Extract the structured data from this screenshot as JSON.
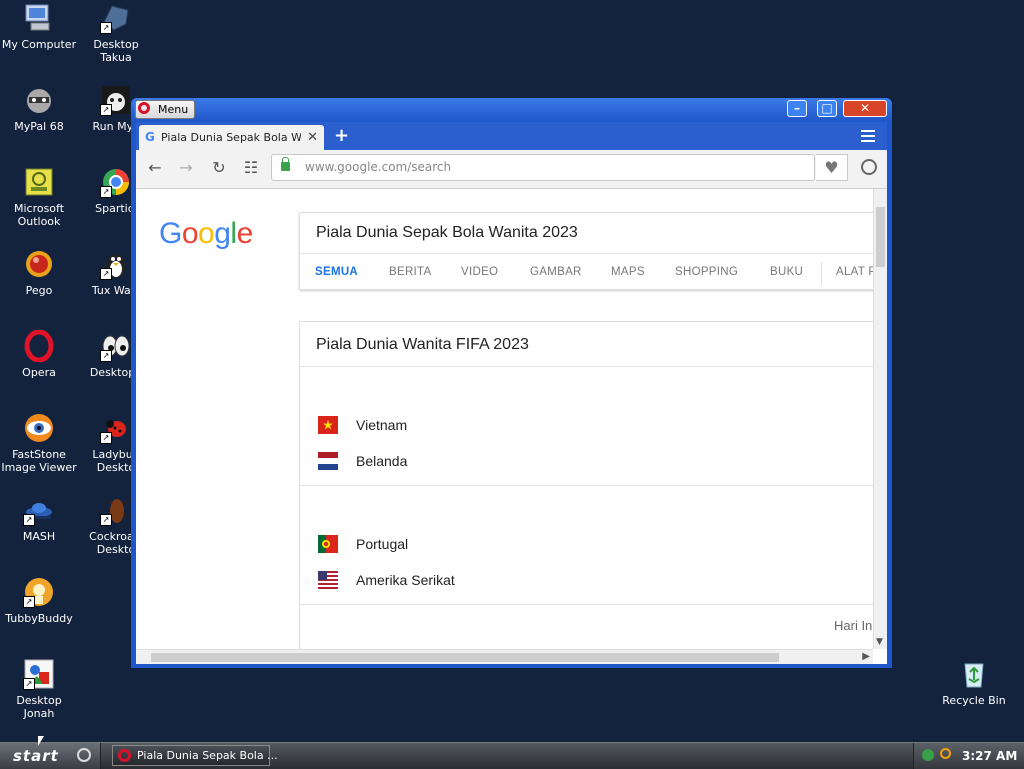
{
  "desktop": {
    "icons": [
      {
        "label": "My Computer"
      },
      {
        "label": "Desktop Takua"
      },
      {
        "label": "MyPal 68"
      },
      {
        "label": "Run MyF"
      },
      {
        "label": "Microsoft\nOutlook"
      },
      {
        "label": "Sparticl"
      },
      {
        "label": "Pego"
      },
      {
        "label": "Tux Walk"
      },
      {
        "label": "Opera"
      },
      {
        "label": "DesktopE"
      },
      {
        "label": "FastStone\nImage Viewer"
      },
      {
        "label": "Ladybug\nDeskto"
      },
      {
        "label": "MASH"
      },
      {
        "label": "Cockroacl\nDeskto"
      },
      {
        "label": "TubbyBuddy"
      },
      {
        "label": "Desktop Jonah"
      },
      {
        "label": "Recycle Bin"
      }
    ]
  },
  "window": {
    "menu_label": "Menu",
    "min": "–",
    "max": "□",
    "close": "✕"
  },
  "tab": {
    "title": "Piala Dunia Sepak Bola Wanita",
    "close": "✕",
    "favicon": "G",
    "new_tab": "+"
  },
  "nav": {
    "back": "←",
    "forward": "→",
    "reload": "↻",
    "speed_dial": "☷",
    "url_host": "www.google.com",
    "url_path": "/search",
    "heart": "♥"
  },
  "search": {
    "logo": [
      "G",
      "o",
      "o",
      "g",
      "l",
      "e"
    ],
    "logo_colors": [
      "#4285f4",
      "#ea4335",
      "#fbbc05",
      "#4285f4",
      "#34a853",
      "#ea4335"
    ],
    "query": "Piala Dunia Sepak Bola Wanita 2023",
    "tabs": [
      "SEMUA",
      "BERITA",
      "VIDEO",
      "GAMBAR",
      "MAPS",
      "SHOPPING",
      "BUKU",
      "ALAT P"
    ],
    "active_tab": "SEMUA"
  },
  "result": {
    "title": "Piala Dunia Wanita FIFA 2023",
    "matches": [
      {
        "team1": "Vietnam",
        "team2": "Belanda"
      },
      {
        "team1": "Portugal",
        "team2": "Amerika Serikat"
      }
    ],
    "footer": "Hari In"
  },
  "taskbar": {
    "start": "start",
    "task_title": "Piala Dunia Sepak Bola ...",
    "clock": "3:27 AM"
  }
}
